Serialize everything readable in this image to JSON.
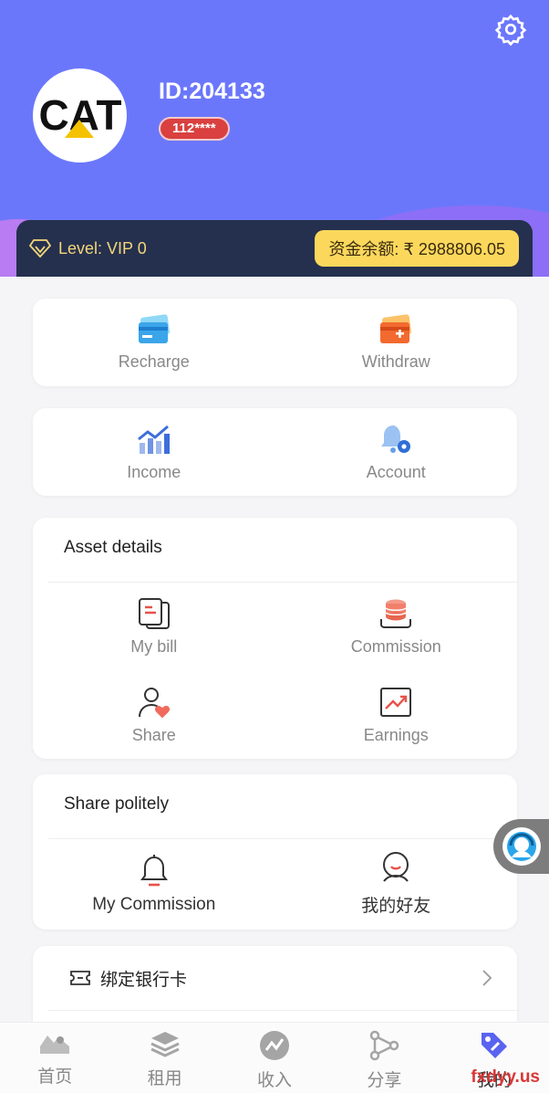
{
  "header": {
    "user_id": "ID:204133",
    "phone": "112****",
    "logo_text": "CAT",
    "level_label": "Level:  VIP 0",
    "balance_label": "资金余额: ₹ 2988806.05"
  },
  "quick_actions": [
    {
      "label": "Recharge",
      "icon": "card-icon"
    },
    {
      "label": "Withdraw",
      "icon": "wallet-plus-icon"
    }
  ],
  "quick_actions2": [
    {
      "label": "Income",
      "icon": "chart-up-icon"
    },
    {
      "label": "Account",
      "icon": "bell-gear-icon"
    }
  ],
  "asset_details": {
    "title": "Asset details",
    "items": [
      {
        "label": "My bill",
        "icon": "bill-icon"
      },
      {
        "label": "Commission",
        "icon": "coins-icon"
      },
      {
        "label": "Share",
        "icon": "user-heart-icon"
      },
      {
        "label": "Earnings",
        "icon": "trend-icon"
      }
    ]
  },
  "share_politely": {
    "title": "Share politely",
    "items": [
      {
        "label": "My Commission",
        "icon": "bell-icon"
      },
      {
        "label": "我的好友",
        "icon": "friend-icon"
      }
    ]
  },
  "bank": {
    "label": "绑定银行卡"
  },
  "tabbar": [
    {
      "label": "首页",
      "icon": "home-icon"
    },
    {
      "label": "租用",
      "icon": "layers-icon"
    },
    {
      "label": "收入",
      "icon": "income-icon"
    },
    {
      "label": "分享",
      "icon": "share-icon"
    },
    {
      "label": "我的",
      "icon": "tag-icon"
    }
  ],
  "watermark": "fxdyy.us",
  "colors": {
    "header": "#6b77fb",
    "level_bar": "#25304e",
    "balance_bg": "#fbd85c",
    "badge": "#d9403f"
  }
}
